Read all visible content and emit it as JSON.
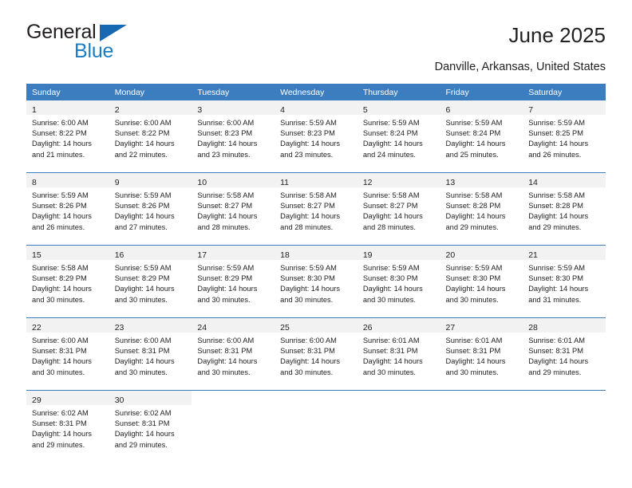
{
  "brand": {
    "name_part1": "General",
    "name_part2": "Blue",
    "triangle_color": "#1668b3",
    "blue_color": "#1a7cc4"
  },
  "header": {
    "title": "June 2025",
    "location": "Danville, Arkansas, United States"
  },
  "theme": {
    "header_blue": "#3b7dbf",
    "daynum_band": "#f2f2f2",
    "text": "#222222"
  },
  "weekday_headers": [
    "Sunday",
    "Monday",
    "Tuesday",
    "Wednesday",
    "Thursday",
    "Friday",
    "Saturday"
  ],
  "weeks": [
    [
      {
        "day": "1",
        "sunrise": "Sunrise: 6:00 AM",
        "sunset": "Sunset: 8:22 PM",
        "daylight_1": "Daylight: 14 hours",
        "daylight_2": "and 21 minutes."
      },
      {
        "day": "2",
        "sunrise": "Sunrise: 6:00 AM",
        "sunset": "Sunset: 8:22 PM",
        "daylight_1": "Daylight: 14 hours",
        "daylight_2": "and 22 minutes."
      },
      {
        "day": "3",
        "sunrise": "Sunrise: 6:00 AM",
        "sunset": "Sunset: 8:23 PM",
        "daylight_1": "Daylight: 14 hours",
        "daylight_2": "and 23 minutes."
      },
      {
        "day": "4",
        "sunrise": "Sunrise: 5:59 AM",
        "sunset": "Sunset: 8:23 PM",
        "daylight_1": "Daylight: 14 hours",
        "daylight_2": "and 23 minutes."
      },
      {
        "day": "5",
        "sunrise": "Sunrise: 5:59 AM",
        "sunset": "Sunset: 8:24 PM",
        "daylight_1": "Daylight: 14 hours",
        "daylight_2": "and 24 minutes."
      },
      {
        "day": "6",
        "sunrise": "Sunrise: 5:59 AM",
        "sunset": "Sunset: 8:24 PM",
        "daylight_1": "Daylight: 14 hours",
        "daylight_2": "and 25 minutes."
      },
      {
        "day": "7",
        "sunrise": "Sunrise: 5:59 AM",
        "sunset": "Sunset: 8:25 PM",
        "daylight_1": "Daylight: 14 hours",
        "daylight_2": "and 26 minutes."
      }
    ],
    [
      {
        "day": "8",
        "sunrise": "Sunrise: 5:59 AM",
        "sunset": "Sunset: 8:26 PM",
        "daylight_1": "Daylight: 14 hours",
        "daylight_2": "and 26 minutes."
      },
      {
        "day": "9",
        "sunrise": "Sunrise: 5:59 AM",
        "sunset": "Sunset: 8:26 PM",
        "daylight_1": "Daylight: 14 hours",
        "daylight_2": "and 27 minutes."
      },
      {
        "day": "10",
        "sunrise": "Sunrise: 5:58 AM",
        "sunset": "Sunset: 8:27 PM",
        "daylight_1": "Daylight: 14 hours",
        "daylight_2": "and 28 minutes."
      },
      {
        "day": "11",
        "sunrise": "Sunrise: 5:58 AM",
        "sunset": "Sunset: 8:27 PM",
        "daylight_1": "Daylight: 14 hours",
        "daylight_2": "and 28 minutes."
      },
      {
        "day": "12",
        "sunrise": "Sunrise: 5:58 AM",
        "sunset": "Sunset: 8:27 PM",
        "daylight_1": "Daylight: 14 hours",
        "daylight_2": "and 28 minutes."
      },
      {
        "day": "13",
        "sunrise": "Sunrise: 5:58 AM",
        "sunset": "Sunset: 8:28 PM",
        "daylight_1": "Daylight: 14 hours",
        "daylight_2": "and 29 minutes."
      },
      {
        "day": "14",
        "sunrise": "Sunrise: 5:58 AM",
        "sunset": "Sunset: 8:28 PM",
        "daylight_1": "Daylight: 14 hours",
        "daylight_2": "and 29 minutes."
      }
    ],
    [
      {
        "day": "15",
        "sunrise": "Sunrise: 5:58 AM",
        "sunset": "Sunset: 8:29 PM",
        "daylight_1": "Daylight: 14 hours",
        "daylight_2": "and 30 minutes."
      },
      {
        "day": "16",
        "sunrise": "Sunrise: 5:59 AM",
        "sunset": "Sunset: 8:29 PM",
        "daylight_1": "Daylight: 14 hours",
        "daylight_2": "and 30 minutes."
      },
      {
        "day": "17",
        "sunrise": "Sunrise: 5:59 AM",
        "sunset": "Sunset: 8:29 PM",
        "daylight_1": "Daylight: 14 hours",
        "daylight_2": "and 30 minutes."
      },
      {
        "day": "18",
        "sunrise": "Sunrise: 5:59 AM",
        "sunset": "Sunset: 8:30 PM",
        "daylight_1": "Daylight: 14 hours",
        "daylight_2": "and 30 minutes."
      },
      {
        "day": "19",
        "sunrise": "Sunrise: 5:59 AM",
        "sunset": "Sunset: 8:30 PM",
        "daylight_1": "Daylight: 14 hours",
        "daylight_2": "and 30 minutes."
      },
      {
        "day": "20",
        "sunrise": "Sunrise: 5:59 AM",
        "sunset": "Sunset: 8:30 PM",
        "daylight_1": "Daylight: 14 hours",
        "daylight_2": "and 30 minutes."
      },
      {
        "day": "21",
        "sunrise": "Sunrise: 5:59 AM",
        "sunset": "Sunset: 8:30 PM",
        "daylight_1": "Daylight: 14 hours",
        "daylight_2": "and 31 minutes."
      }
    ],
    [
      {
        "day": "22",
        "sunrise": "Sunrise: 6:00 AM",
        "sunset": "Sunset: 8:31 PM",
        "daylight_1": "Daylight: 14 hours",
        "daylight_2": "and 30 minutes."
      },
      {
        "day": "23",
        "sunrise": "Sunrise: 6:00 AM",
        "sunset": "Sunset: 8:31 PM",
        "daylight_1": "Daylight: 14 hours",
        "daylight_2": "and 30 minutes."
      },
      {
        "day": "24",
        "sunrise": "Sunrise: 6:00 AM",
        "sunset": "Sunset: 8:31 PM",
        "daylight_1": "Daylight: 14 hours",
        "daylight_2": "and 30 minutes."
      },
      {
        "day": "25",
        "sunrise": "Sunrise: 6:00 AM",
        "sunset": "Sunset: 8:31 PM",
        "daylight_1": "Daylight: 14 hours",
        "daylight_2": "and 30 minutes."
      },
      {
        "day": "26",
        "sunrise": "Sunrise: 6:01 AM",
        "sunset": "Sunset: 8:31 PM",
        "daylight_1": "Daylight: 14 hours",
        "daylight_2": "and 30 minutes."
      },
      {
        "day": "27",
        "sunrise": "Sunrise: 6:01 AM",
        "sunset": "Sunset: 8:31 PM",
        "daylight_1": "Daylight: 14 hours",
        "daylight_2": "and 30 minutes."
      },
      {
        "day": "28",
        "sunrise": "Sunrise: 6:01 AM",
        "sunset": "Sunset: 8:31 PM",
        "daylight_1": "Daylight: 14 hours",
        "daylight_2": "and 29 minutes."
      }
    ],
    [
      {
        "day": "29",
        "sunrise": "Sunrise: 6:02 AM",
        "sunset": "Sunset: 8:31 PM",
        "daylight_1": "Daylight: 14 hours",
        "daylight_2": "and 29 minutes."
      },
      {
        "day": "30",
        "sunrise": "Sunrise: 6:02 AM",
        "sunset": "Sunset: 8:31 PM",
        "daylight_1": "Daylight: 14 hours",
        "daylight_2": "and 29 minutes."
      },
      {
        "day": "",
        "sunrise": "",
        "sunset": "",
        "daylight_1": "",
        "daylight_2": ""
      },
      {
        "day": "",
        "sunrise": "",
        "sunset": "",
        "daylight_1": "",
        "daylight_2": ""
      },
      {
        "day": "",
        "sunrise": "",
        "sunset": "",
        "daylight_1": "",
        "daylight_2": ""
      },
      {
        "day": "",
        "sunrise": "",
        "sunset": "",
        "daylight_1": "",
        "daylight_2": ""
      },
      {
        "day": "",
        "sunrise": "",
        "sunset": "",
        "daylight_1": "",
        "daylight_2": ""
      }
    ]
  ]
}
